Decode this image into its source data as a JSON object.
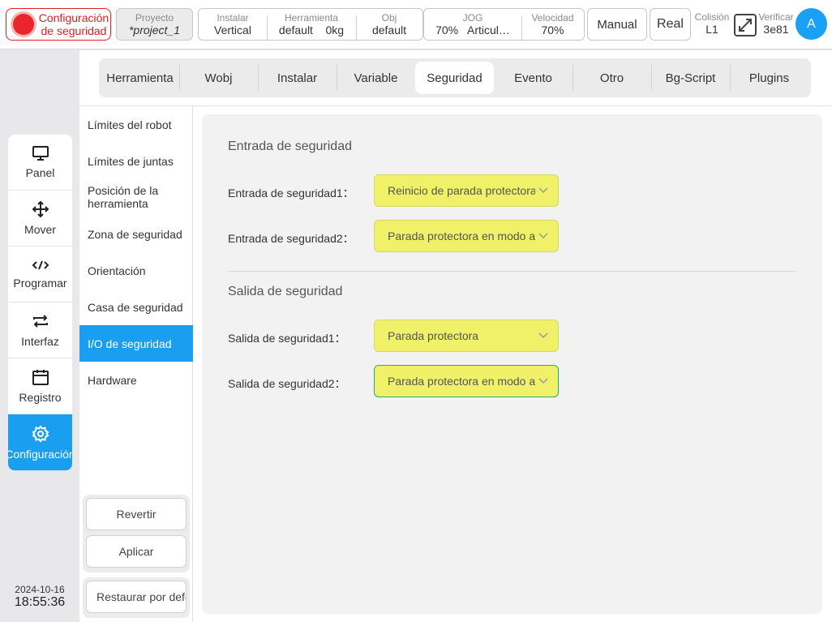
{
  "topbar": {
    "safety_config": "Configuración de seguridad",
    "project_label": "Proyecto",
    "project_value": "*project_1",
    "install": [
      {
        "label": "Instalar",
        "value": "Vertical"
      },
      {
        "label": "Herramienta",
        "value": "default    0kg"
      },
      {
        "label": "Obj",
        "value": "default"
      }
    ],
    "jog": [
      {
        "label": "JOG",
        "value": "70%   Articul…"
      },
      {
        "label": "Velocidad",
        "value": "70%"
      }
    ],
    "mode_button": "Manual",
    "real_button": "Real",
    "collision_label": "Colisión",
    "collision_value": "L1",
    "verify_label": "Verificar",
    "verify_value": "3e81",
    "avatar_letter": "A"
  },
  "leftnav": [
    {
      "label": "Panel",
      "icon": "monitor-icon"
    },
    {
      "label": "Mover",
      "icon": "move-icon"
    },
    {
      "label": "Programar",
      "icon": "code-icon"
    },
    {
      "label": "Interfaz",
      "icon": "swap-icon"
    },
    {
      "label": "Registro",
      "icon": "calendar-icon"
    },
    {
      "label": "Configuración",
      "icon": "gear-icon",
      "active": true
    }
  ],
  "datetime": {
    "date": "2024-10-16",
    "time": "18:55:36"
  },
  "tabs": [
    "Herramienta",
    "Wobj",
    "Instalar",
    "Variable",
    "Seguridad",
    "Evento",
    "Otro",
    "Bg-Script",
    "Plugins"
  ],
  "active_tab": "Seguridad",
  "sidemenu": [
    "Límites del robot",
    "Límites de juntas",
    "Posición de la herramienta",
    "Zona de seguridad",
    "Orientación",
    "Casa de seguridad",
    "I/O de seguridad",
    "Hardware"
  ],
  "active_sidemenu": "I/O de seguridad",
  "actions": {
    "revert": "Revertir",
    "apply": "Aplicar",
    "restore": "Restaurar por defecto"
  },
  "safety_input": {
    "title": "Entrada de seguridad",
    "rows": [
      {
        "label": "Entrada de seguridad1：",
        "value": "Reinicio de parada protectora"
      },
      {
        "label": "Entrada de seguridad2：",
        "value": "Parada protectora en modo automático"
      }
    ]
  },
  "safety_output": {
    "title": "Salida de seguridad",
    "rows": [
      {
        "label": "Salida de seguridad1：",
        "value": "Parada protectora"
      },
      {
        "label": "Salida de seguridad2：",
        "value": "Parada protectora en modo automático"
      }
    ]
  },
  "colors": {
    "accent": "#1a9ff0",
    "select_bg": "#f0f169",
    "alert": "#e02020"
  }
}
